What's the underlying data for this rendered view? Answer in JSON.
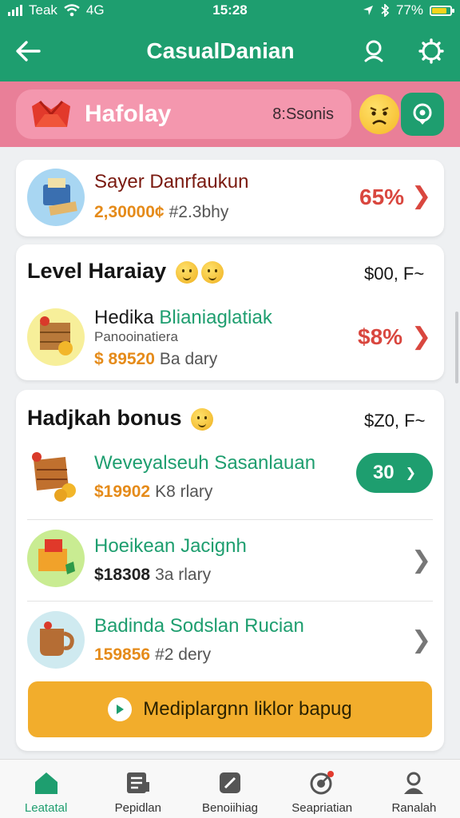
{
  "status": {
    "carrier": "Teak",
    "network": "4G",
    "time": "15:28",
    "battery": "77%"
  },
  "appbar": {
    "title": "CasualDanian",
    "back_icon": "back-arrow-icon",
    "search_icon": "search-icon",
    "settings_icon": "gear-icon"
  },
  "banner": {
    "name": "Hafolay",
    "sub": "8:Ssonis"
  },
  "top_item": {
    "title": "Sayer Danrfaukun",
    "price": "2,30000¢",
    "per": "#2.3bhy",
    "percent": "65%"
  },
  "level_section": {
    "title": "Level Haraiay",
    "right": "$00, F~",
    "item": {
      "title_a": "Hedika",
      "title_b": "Blianiaglatiak",
      "subtitle": "Panooinatiera",
      "price": "$ 89520",
      "per": "Ba dary",
      "percent": "$8%"
    }
  },
  "bonus_section": {
    "title": "Hadjkah bonus",
    "right": "$Z0, F~",
    "items": [
      {
        "title": "Weveyalseuh Sasanlauan",
        "price": "$19902",
        "per": "K8 rlary",
        "button": "30"
      },
      {
        "title": "Hoeikean Jacignh",
        "price": "$18308",
        "per": "3a rlary"
      },
      {
        "title": "Badinda Sodslan Rucian",
        "price": "159856",
        "per": "#2 dery"
      }
    ],
    "cta": "Mediplargnn liklor bapug"
  },
  "tabs": [
    {
      "label": "Leatatal",
      "icon": "home-icon"
    },
    {
      "label": "Pepidlan",
      "icon": "document-icon"
    },
    {
      "label": "Benoiihiag",
      "icon": "edit-icon"
    },
    {
      "label": "Seapriatian",
      "icon": "target-icon"
    },
    {
      "label": "Ranalah",
      "icon": "profile-icon"
    }
  ],
  "colors": {
    "primary": "#1e9e6f",
    "banner": "#f497ae",
    "accent_orange": "#f2ad2c",
    "alert_red": "#d9473f"
  }
}
